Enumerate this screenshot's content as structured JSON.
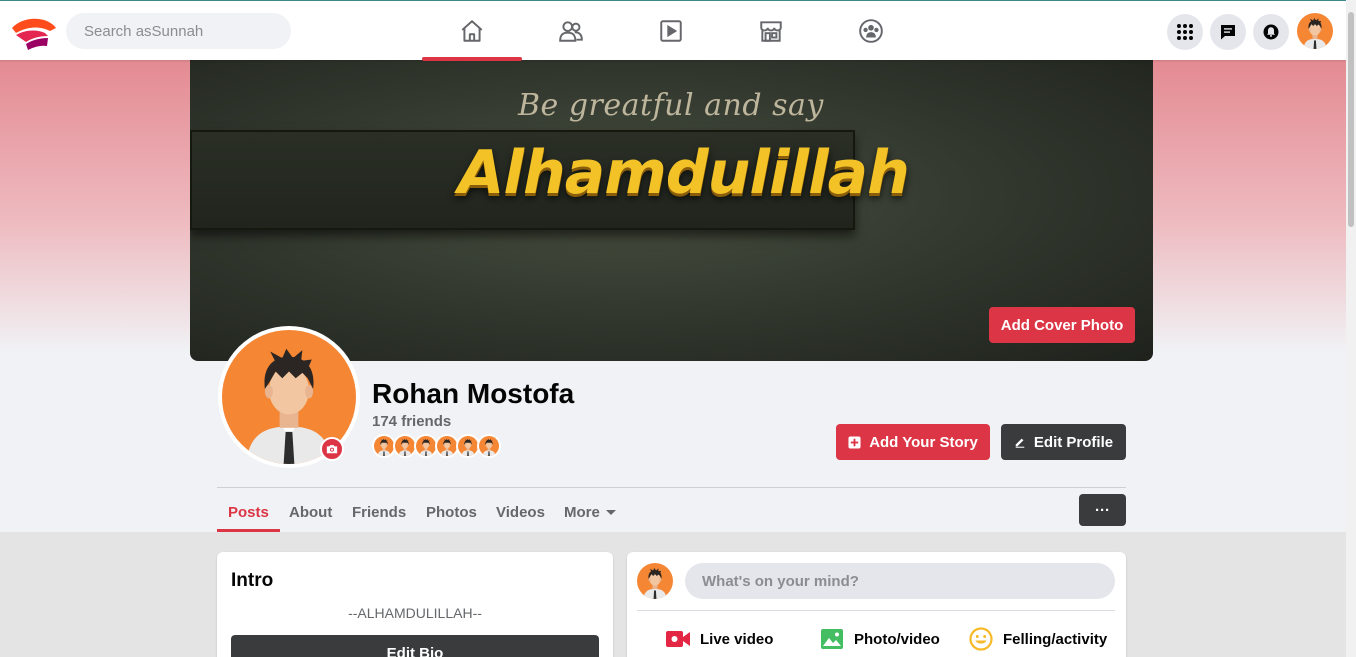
{
  "nav": {
    "search_placeholder": "Search asSunnah",
    "tabs": [
      {
        "icon": "home-icon",
        "active": true
      },
      {
        "icon": "friends-icon",
        "active": false
      },
      {
        "icon": "watch-icon",
        "active": false
      },
      {
        "icon": "marketplace-icon",
        "active": false
      },
      {
        "icon": "groups-icon",
        "active": false
      }
    ],
    "right_buttons": [
      "menu-grid-icon",
      "messenger-icon",
      "notifications-icon"
    ]
  },
  "cover": {
    "subtitle": "Be greatful and say",
    "headline": "Alhamdulillah",
    "add_cover_label": "Add Cover Photo"
  },
  "profile": {
    "name": "Rohan Mostofa",
    "friends_count": "174 friends",
    "add_story_label": "Add Your Story",
    "edit_profile_label": "Edit Profile"
  },
  "profile_tabs": [
    "Posts",
    "About",
    "Friends",
    "Photos",
    "Videos",
    "More"
  ],
  "more_options_label": "···",
  "intro": {
    "title": "Intro",
    "bio": "--ALHAMDULILLAH--",
    "edit_bio_label": "Edit Bio"
  },
  "composer": {
    "placeholder": "What's on your mind?",
    "actions": [
      {
        "label": "Live video",
        "icon": "live-video-icon",
        "color": "#e42645"
      },
      {
        "label": "Photo/video",
        "icon": "photo-icon",
        "color": "#45bd62"
      },
      {
        "label": "Felling/activity",
        "icon": "smiley-icon",
        "color": "#f7b928"
      }
    ]
  },
  "colors": {
    "accent": "#dc3545",
    "dark_button": "#3a3b3c",
    "avatar_orange": "#f58634"
  }
}
